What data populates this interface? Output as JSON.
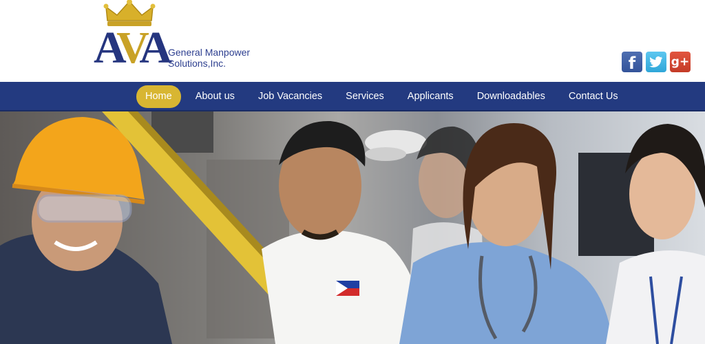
{
  "brand": {
    "monogram": "AVA",
    "name_line1": "General Manpower",
    "name_line2": "Solutions,Inc."
  },
  "social": [
    {
      "label": "f",
      "icon": "facebook-icon"
    },
    {
      "label": "t",
      "icon": "twitter-icon"
    },
    {
      "label": "g+",
      "icon": "google-plus-icon"
    }
  ],
  "nav": {
    "items": [
      "Home",
      "About us",
      "Job Vacancies",
      "Services",
      "Applicants",
      "Downloadables",
      "Contact Us"
    ],
    "active_index": 0
  },
  "colors": {
    "nav_background": "#233a80",
    "active_pill": "#d8b632",
    "brand_blue": "#25357f",
    "brand_gold": "#c9a227"
  }
}
